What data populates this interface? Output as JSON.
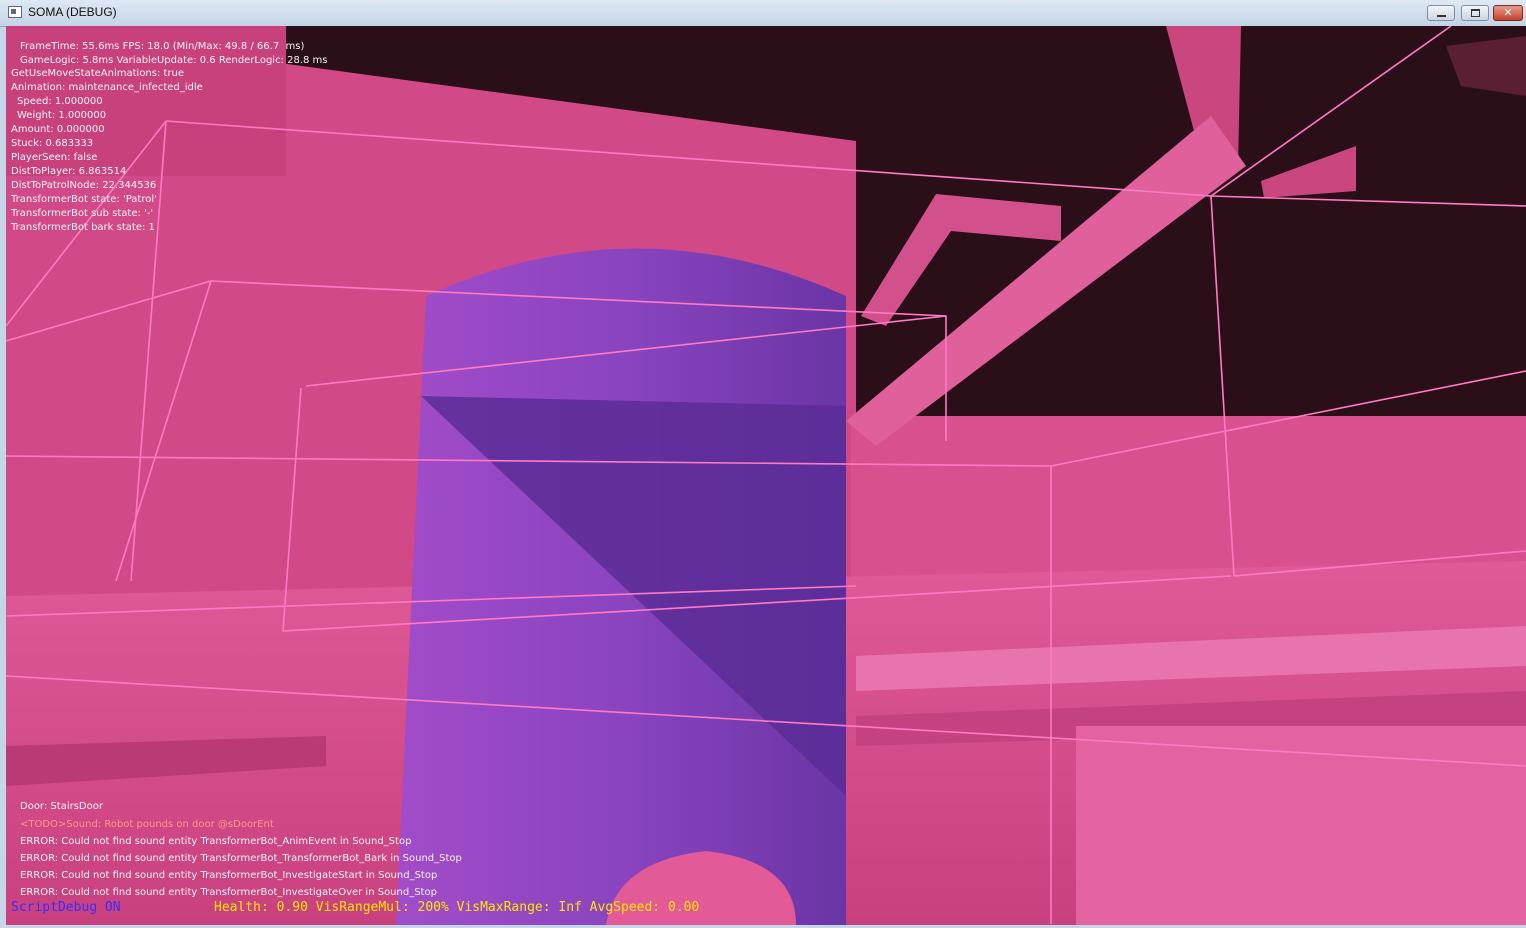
{
  "window": {
    "title": "SOMA (DEBUG)",
    "controls": {
      "minimize": "minimize",
      "maximize": "maximize",
      "close": "✕"
    }
  },
  "debug_stats": [
    "FrameTime: 55.6ms FPS: 18.0 (Min/Max: 49.8 / 66.7  ms)",
    "GameLogic: 5.8ms VariableUpdate: 0.6 RenderLogic: 28.8 ms",
    "GetUseMoveStateAnimations: true",
    "Animation: maintenance_infected_idle",
    "Speed: 1.000000",
    "Weight: 1.000000",
    "Amount: 0.000000",
    "Stuck: 0.683333",
    "PlayerSeen: false",
    "DistToPlayer: 6.863514",
    "DistToPatrolNode: 22.344536",
    "TransformerBot state: 'Patrol'",
    "TransformerBot sub state: '-'",
    "TransformerBot bark state: 1"
  ],
  "log_lines": [
    {
      "text": "Door: StairsDoor",
      "kind": "info"
    },
    {
      "text": "<TODO>Sound: Robot pounds on door @sDoorEnt",
      "kind": "todo"
    },
    {
      "text": "ERROR: Could not find sound entity TransformerBot_AnimEvent in Sound_Stop",
      "kind": "error"
    },
    {
      "text": "ERROR: Could not find sound entity TransformerBot_TransformerBot_Bark in Sound_Stop",
      "kind": "error"
    },
    {
      "text": "ERROR: Could not find sound entity TransformerBot_InvestigateStart in Sound_Stop",
      "kind": "error"
    },
    {
      "text": "ERROR: Could not find sound entity TransformerBot_InvestigateOver in Sound_Stop",
      "kind": "error"
    }
  ],
  "status": {
    "script_debug": "ScriptDebug ON",
    "health_line": "Health: 0.90 VisRangeMul: 200% VisMaxRange: Inf AvgSpeed: 0.00"
  },
  "colors": {
    "wall_pink": "#d34b8a",
    "dark_ceiling": "#2b0f18",
    "cylinder_purple": "#7b3fb0",
    "wire_pink": "#ff7ac4",
    "status_blue": "#3a2cff",
    "status_yellow": "#ffe600"
  }
}
